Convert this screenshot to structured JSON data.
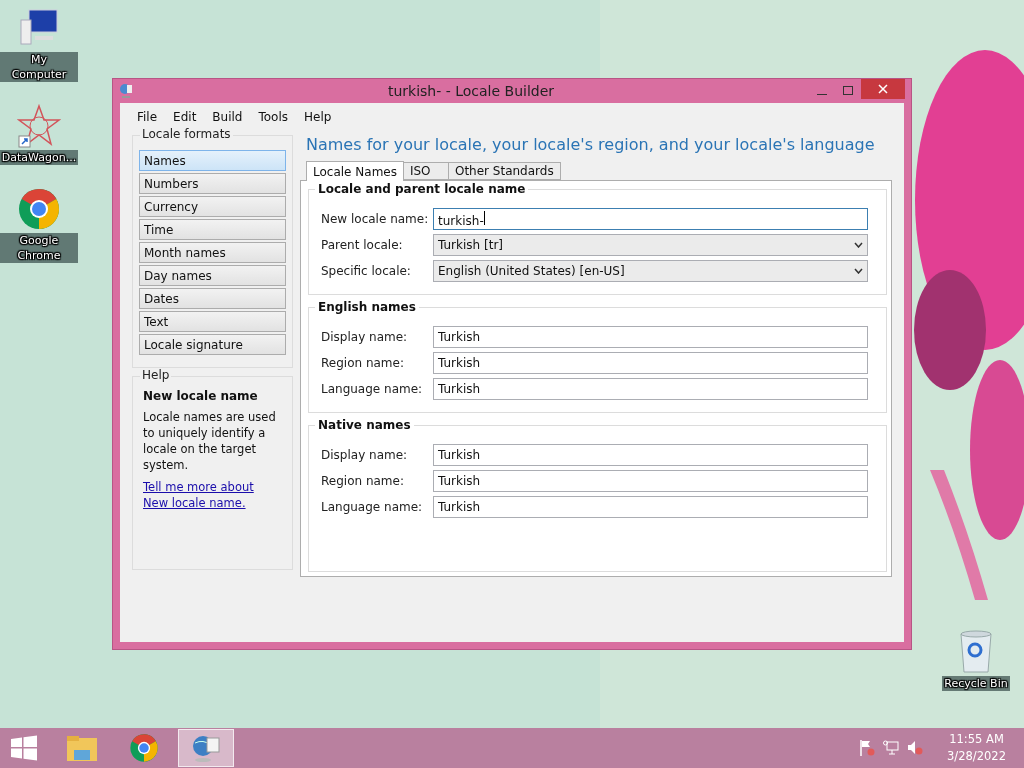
{
  "desktop_icons": [
    {
      "label": "My Computer",
      "kind": "computer"
    },
    {
      "label": "DataWagon...",
      "kind": "star"
    },
    {
      "label": "Google Chrome",
      "kind": "chrome"
    }
  ],
  "recycle_bin": {
    "label": "Recycle Bin"
  },
  "window": {
    "title": "turkish- - Locale Builder"
  },
  "menu": [
    "File",
    "Edit",
    "Build",
    "Tools",
    "Help"
  ],
  "sidebar": {
    "title": "Locale formats",
    "items": [
      {
        "label": "Names",
        "selected": true
      },
      {
        "label": "Numbers",
        "selected": false
      },
      {
        "label": "Currency",
        "selected": false
      },
      {
        "label": "Time",
        "selected": false
      },
      {
        "label": "Month names",
        "selected": false
      },
      {
        "label": "Day names",
        "selected": false
      },
      {
        "label": "Dates",
        "selected": false
      },
      {
        "label": "Text",
        "selected": false
      },
      {
        "label": "Locale signature",
        "selected": false
      }
    ]
  },
  "help": {
    "title": "Help",
    "heading": "New locale name",
    "text": "Locale names are used to uniquely identify a locale on the target system.",
    "link": "Tell me more about New locale name."
  },
  "heading": "Names for your locale, your locale's region, and your locale's language",
  "tabs": [
    {
      "label": "Locale Names",
      "selected": true
    },
    {
      "label": "ISO",
      "selected": false
    },
    {
      "label": "Other Standards",
      "selected": false
    }
  ],
  "groups": [
    {
      "title": "Locale and parent locale name",
      "fields": [
        {
          "label": "New locale name:",
          "value": "turkish-",
          "kind": "text",
          "focused": true
        },
        {
          "label": "Parent locale:",
          "value": "Turkish [tr]",
          "kind": "dropdown",
          "focused": false
        },
        {
          "label": "Specific locale:",
          "value": "English (United States) [en-US]",
          "kind": "dropdown",
          "focused": false
        }
      ]
    },
    {
      "title": "English names",
      "fields": [
        {
          "label": "Display name:",
          "value": "Turkish",
          "kind": "text",
          "focused": false
        },
        {
          "label": "Region name:",
          "value": "Turkish",
          "kind": "text",
          "focused": false
        },
        {
          "label": "Language name:",
          "value": "Turkish",
          "kind": "text",
          "focused": false
        }
      ]
    },
    {
      "title": "Native names",
      "fields": [
        {
          "label": "Display name:",
          "value": "Turkish",
          "kind": "text",
          "focused": false
        },
        {
          "label": "Region name:",
          "value": "Turkish",
          "kind": "text",
          "focused": false
        },
        {
          "label": "Language name:",
          "value": "Turkish",
          "kind": "text",
          "focused": false
        }
      ]
    }
  ],
  "taskbar": {
    "apps": [
      {
        "kind": "folder",
        "active": false
      },
      {
        "kind": "chrome",
        "active": false
      },
      {
        "kind": "globe",
        "active": true
      }
    ],
    "clock": {
      "time": "11:55 AM",
      "date": "3/28/2022"
    }
  }
}
